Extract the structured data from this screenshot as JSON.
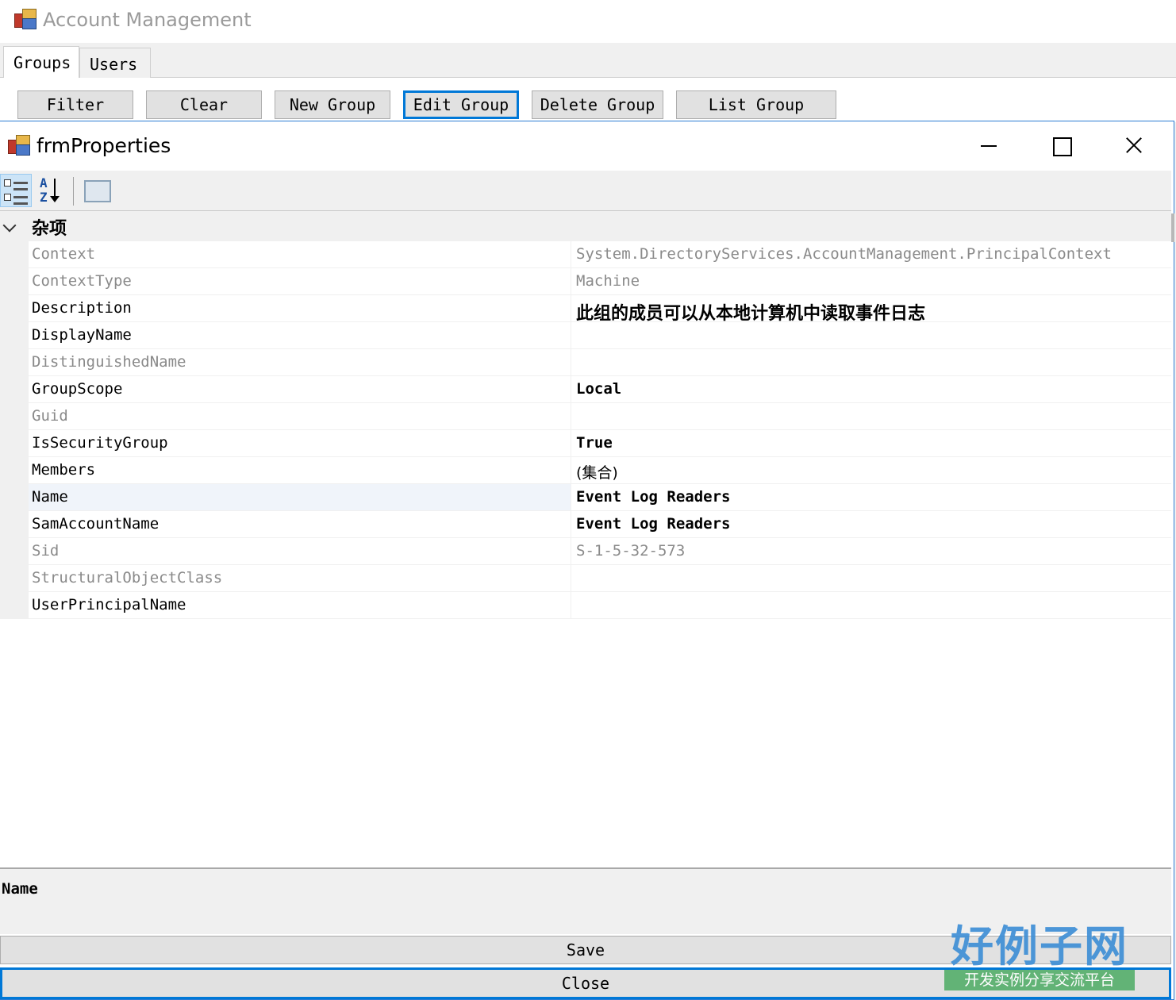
{
  "parent": {
    "title": "Account Management",
    "tabs": [
      "Groups",
      "Users"
    ],
    "buttons": [
      "Filter",
      "Clear",
      "New Group",
      "Edit Group",
      "Delete Group",
      "List Group"
    ],
    "focused_button": "Edit Group"
  },
  "child": {
    "title": "frmProperties",
    "toolbar": {
      "categorized_icon": "categorized-icon",
      "alphabetical_icon": "alphabetical-sort-icon",
      "property_pages_icon": "property-pages-icon",
      "alpha_top": "A",
      "alpha_bottom": "Z"
    },
    "category": "杂项",
    "properties": [
      {
        "name": "Context",
        "value": "System.DirectoryServices.AccountManagement.PrincipalContext",
        "readonly": true
      },
      {
        "name": "ContextType",
        "value": "Machine",
        "readonly": true
      },
      {
        "name": "Description",
        "value": "此组的成员可以从本地计算机中读取事件日志",
        "readonly": false
      },
      {
        "name": "DisplayName",
        "value": "",
        "readonly": false
      },
      {
        "name": "DistinguishedName",
        "value": "",
        "readonly": true
      },
      {
        "name": "GroupScope",
        "value": "Local",
        "readonly": false
      },
      {
        "name": "Guid",
        "value": "",
        "readonly": true
      },
      {
        "name": "IsSecurityGroup",
        "value": "True",
        "readonly": false
      },
      {
        "name": "Members",
        "value": "(集合)",
        "readonly": false
      },
      {
        "name": "Name",
        "value": "Event Log Readers",
        "readonly": false
      },
      {
        "name": "SamAccountName",
        "value": "Event Log Readers",
        "readonly": false
      },
      {
        "name": "Sid",
        "value": "S-1-5-32-573",
        "readonly": true
      },
      {
        "name": "StructuralObjectClass",
        "value": "",
        "readonly": true
      },
      {
        "name": "UserPrincipalName",
        "value": "",
        "readonly": false
      }
    ],
    "help_title": "Name",
    "save_label": "Save",
    "close_label": "Close"
  },
  "watermark": {
    "title": "好例子网",
    "subtitle": "开发实例分享交流平台"
  },
  "colors": {
    "focus": "#0078d7",
    "readonly_text": "#8a8a8a",
    "watermark_blue": "#3f8fd6",
    "watermark_green": "#58b06e"
  }
}
